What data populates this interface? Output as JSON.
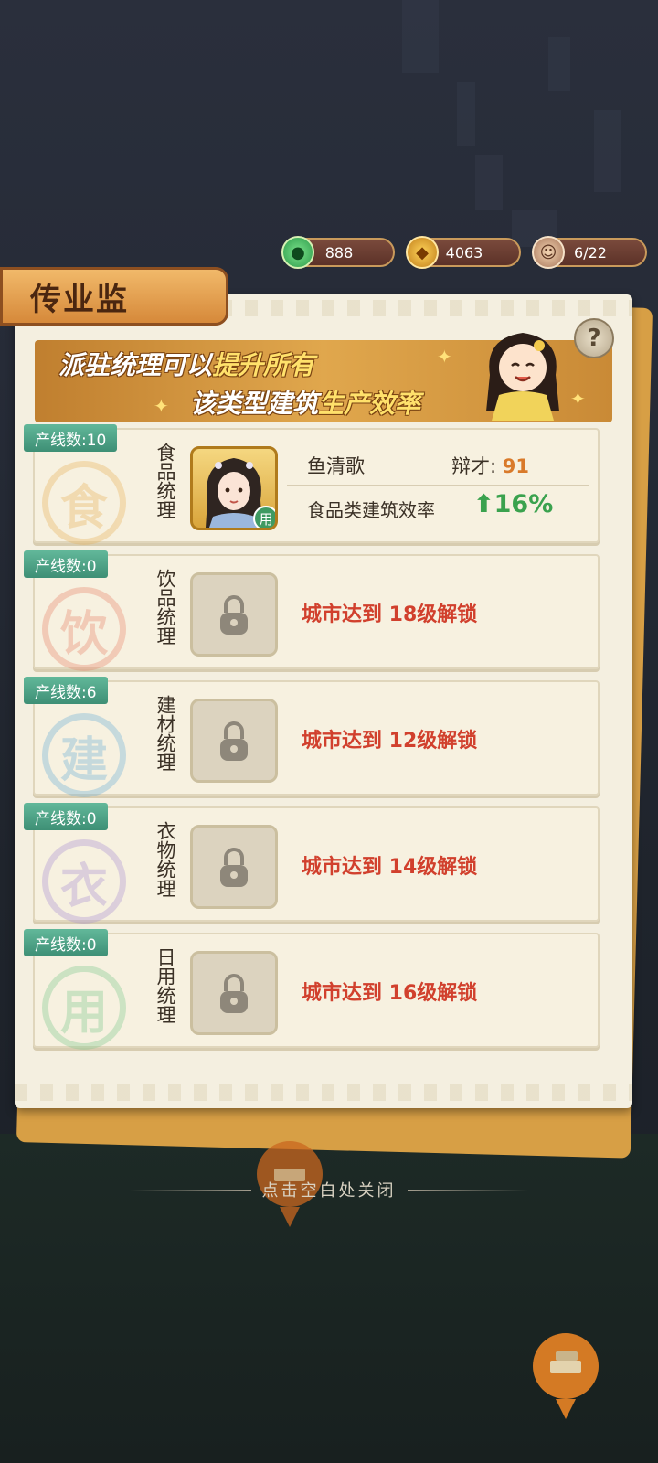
{
  "resources": {
    "jade": {
      "value": "888",
      "icon": "jade-coin-icon"
    },
    "coin": {
      "value": "4063",
      "icon": "copper-coin-icon"
    },
    "people": {
      "value": "6/22",
      "icon": "worker-icon"
    }
  },
  "panel": {
    "title": "传业监",
    "banner": {
      "line1_a": "派驻统理可以",
      "line1_b": "提升所有",
      "line2_a": "该类型建筑",
      "line2_b": "生产效率"
    },
    "help_icon": "?",
    "rows": [
      {
        "badge": "产线数:10",
        "big_char": "食",
        "category": "食品统理",
        "color": "#e8b25a",
        "state": "assigned",
        "manager_name": "鱼清歌",
        "stat_label": "辩才:",
        "stat_value": "91",
        "efficiency_label": "食品类建筑效率",
        "efficiency_value": "16%",
        "used_tag": "用"
      },
      {
        "badge": "产线数:0",
        "big_char": "饮",
        "category": "饮品统理",
        "color": "#e8836a",
        "state": "locked",
        "lock_message": "城市达到 18级解锁"
      },
      {
        "badge": "产线数:6",
        "big_char": "建",
        "category": "建材统理",
        "color": "#6aaed6",
        "state": "locked",
        "lock_message": "城市达到 12级解锁"
      },
      {
        "badge": "产线数:0",
        "big_char": "衣",
        "category": "衣物统理",
        "color": "#a98fd2",
        "state": "locked",
        "lock_message": "城市达到 14级解锁"
      },
      {
        "badge": "产线数:0",
        "big_char": "用",
        "category": "日用统理",
        "color": "#7cc98c",
        "state": "locked",
        "lock_message": "城市达到 16级解锁"
      }
    ]
  },
  "close_hint": "点击空白处关闭"
}
